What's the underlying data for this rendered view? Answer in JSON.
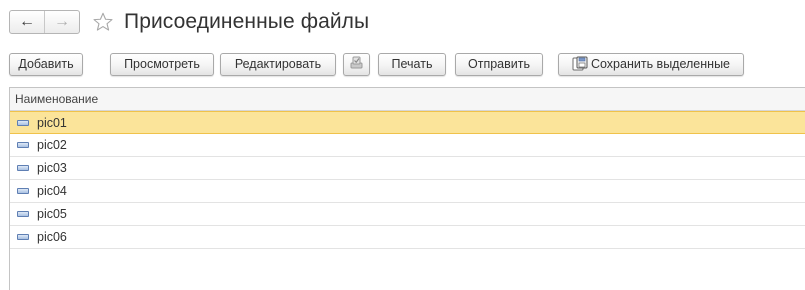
{
  "header": {
    "title": "Присоединенные файлы",
    "back_icon": "←",
    "forward_icon": "→"
  },
  "toolbar": {
    "add_label": "Добавить",
    "view_label": "Просмотреть",
    "edit_label": "Редактировать",
    "print_label": "Печать",
    "send_label": "Отправить",
    "save_selected_label": "Сохранить выделенные"
  },
  "table": {
    "column_name": "Наименование",
    "rows": [
      "pic01",
      "pic02",
      "pic03",
      "pic04",
      "pic05",
      "pic06"
    ],
    "selected_row": "pic01"
  },
  "colors": {
    "selection_fill": "#fbe49a",
    "selection_border": "#f0c24a",
    "file_icon": "#5f7fb3"
  }
}
